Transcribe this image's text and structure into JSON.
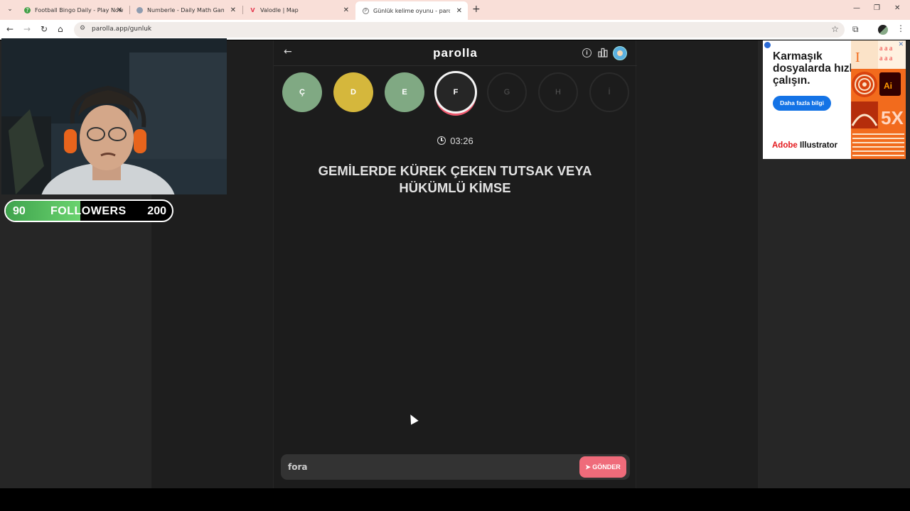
{
  "browser": {
    "tabs": [
      {
        "title": "Football Bingo Daily - Play Now",
        "favicon_color": "#43a047"
      },
      {
        "title": "Numberle - Daily Math Game &",
        "favicon_color": "#8e9cb0"
      },
      {
        "title": "Valodle | Map",
        "favicon_color": "#e53950"
      },
      {
        "title": "Günlük kelime oyunu - parolla",
        "favicon_color": "#777777"
      }
    ],
    "url": "parolla.app/gunluk"
  },
  "game": {
    "logo": "parolla",
    "letters": [
      {
        "char": "Ç",
        "state": "correct"
      },
      {
        "char": "D",
        "state": "passed"
      },
      {
        "char": "E",
        "state": "correct"
      },
      {
        "char": "F",
        "state": "current"
      },
      {
        "char": "G",
        "state": "pending"
      },
      {
        "char": "H",
        "state": "pending"
      },
      {
        "char": "İ",
        "state": "pending"
      }
    ],
    "timer": "03:26",
    "question": "GEMİLERDE KÜREK ÇEKEN TUTSAK VEYA HÜKÜMLÜ KİMSE",
    "answer_value": "fora",
    "send_label": "GÖNDER",
    "colors": {
      "correct": "#80a983",
      "passed": "#d5b73c",
      "accent": "#ef6b7a"
    }
  },
  "ad": {
    "headline": "Karmaşık dosyalarda hızlı çalışın.",
    "cta": "Daha fazla bilgi",
    "brand_prefix": "Adobe",
    "brand_product": "Illustrator",
    "art_text": "5X"
  },
  "overlay": {
    "followers_current": "90",
    "followers_label": "FOLLOWERS",
    "followers_goal": "200",
    "followers_progress": 0.45
  }
}
